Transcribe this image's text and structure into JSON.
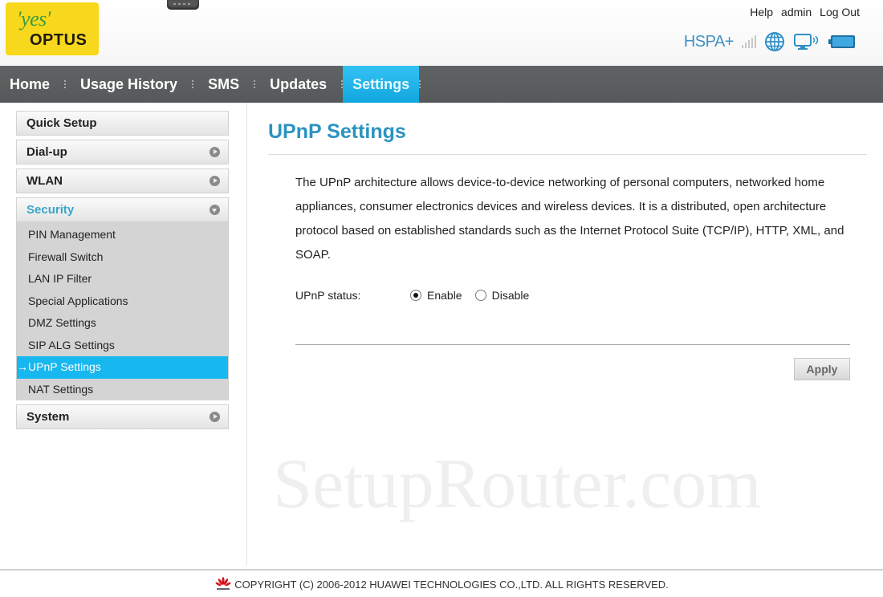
{
  "header": {
    "logo_top": "'yes'",
    "logo_bottom": "OPTUS",
    "links": {
      "help": "Help",
      "user": "admin",
      "logout": "Log Out"
    },
    "status": {
      "network_type": "HSPA+",
      "icons": [
        "signal-strength-icon",
        "internet-globe-icon",
        "wifi-computer-icon",
        "battery-icon"
      ]
    }
  },
  "nav": {
    "items": [
      {
        "label": "Home",
        "active": false
      },
      {
        "label": "Usage History",
        "active": false
      },
      {
        "label": "SMS",
        "active": false
      },
      {
        "label": "Updates",
        "active": false
      },
      {
        "label": "Settings",
        "active": true
      }
    ]
  },
  "sidebar": {
    "quick_setup": "Quick Setup",
    "dialup": "Dial-up",
    "wlan": "WLAN",
    "security": "Security",
    "security_items": [
      "PIN Management",
      "Firewall Switch",
      "LAN IP Filter",
      "Special Applications",
      "DMZ Settings",
      "SIP ALG Settings",
      "→UPnP Settings",
      "NAT Settings"
    ],
    "active_item": "UPnP Settings",
    "system": "System"
  },
  "main": {
    "title": "UPnP Settings",
    "description": "The UPnP architecture allows device-to-device networking of personal computers, networked home appliances, consumer electronics devices and wireless devices. It is a distributed, open architecture protocol based on established standards such as the Internet Protocol Suite (TCP/IP), HTTP, XML, and SOAP.",
    "status_label": "UPnP status:",
    "options": {
      "enable": "Enable",
      "disable": "Disable"
    },
    "selected": "Enable",
    "apply_label": "Apply"
  },
  "watermark": "SetupRouter.com",
  "footer": {
    "copyright": "COPYRIGHT (C) 2006-2012 HUAWEI TECHNOLOGIES CO.,LTD. ALL RIGHTS RESERVED."
  },
  "colors": {
    "accent": "#17b8f0",
    "title": "#2b93bf",
    "nav_bg": "#5a5e5e",
    "logo_bg": "#f7d81c"
  }
}
